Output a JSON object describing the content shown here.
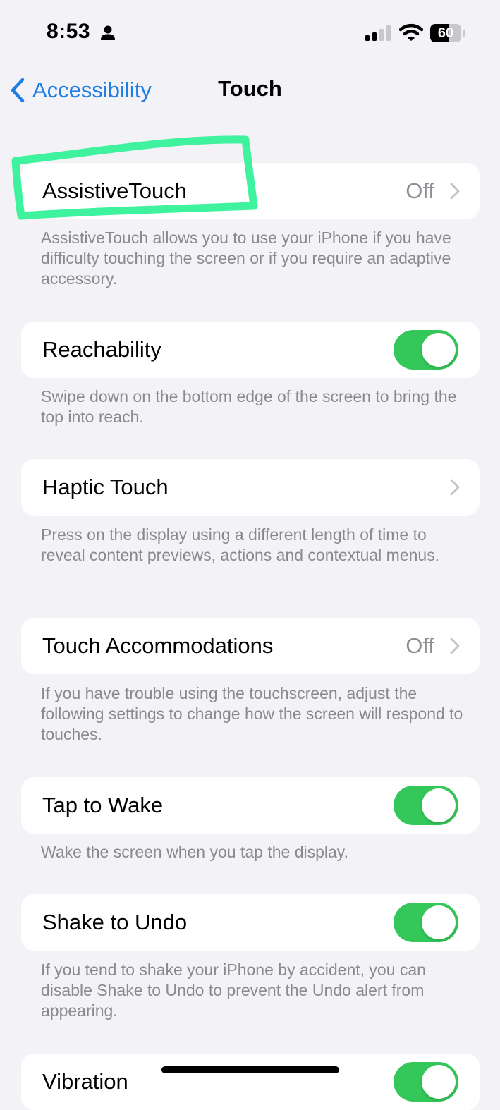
{
  "status_bar": {
    "time": "8:53",
    "battery": "60",
    "battery_level": 0.6,
    "icons": [
      "person-icon",
      "signal-icon",
      "wifi-icon",
      "battery-icon"
    ]
  },
  "nav": {
    "back_label": "Accessibility",
    "title": "Touch"
  },
  "sections": [
    {
      "label": "AssistiveTouch",
      "value": "Off",
      "control": "chevron",
      "footer": "AssistiveTouch allows you to use your iPhone if you have difficulty touching the screen or if you require an adaptive accessory."
    },
    {
      "label": "Reachability",
      "value": "",
      "control": "toggle",
      "toggle_on": true,
      "footer": "Swipe down on the bottom edge of the screen to bring the top into reach."
    },
    {
      "label": "Haptic Touch",
      "value": "",
      "control": "chevron",
      "footer": "Press on the display using a different length of time to reveal content previews, actions and contextual menus."
    },
    {
      "label": "Touch Accommodations",
      "value": "Off",
      "control": "chevron",
      "footer": "If you have trouble using the touchscreen, adjust the following settings to change how the screen will respond to touches."
    },
    {
      "label": "Tap to Wake",
      "value": "",
      "control": "toggle",
      "toggle_on": true,
      "footer": "Wake the screen when you tap the display."
    },
    {
      "label": "Shake to Undo",
      "value": "",
      "control": "toggle",
      "toggle_on": true,
      "footer": "If you tend to shake your iPhone by accident, you can disable Shake to Undo to prevent the Undo alert from appearing."
    },
    {
      "label": "Vibration",
      "value": "",
      "control": "toggle",
      "toggle_on": true,
      "footer": ""
    }
  ],
  "colors": {
    "accent": "#1e7ee6",
    "toggle_on": "#34c759",
    "highlight": "#3ef29e",
    "background": "#f2f2f7"
  }
}
